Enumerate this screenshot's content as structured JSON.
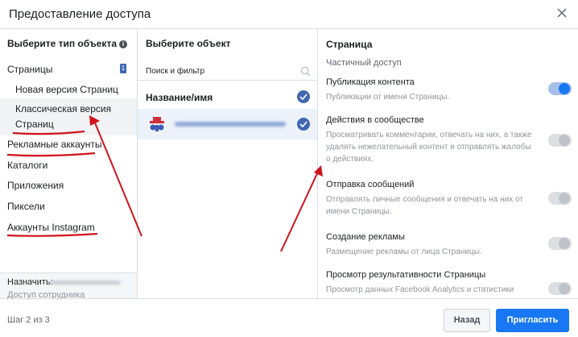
{
  "dialog": {
    "title": "Предоставление доступа"
  },
  "object_types": {
    "header": "Выберите тип объекта",
    "info_icon": "i",
    "pages_label": "Страницы",
    "pages_count": "1",
    "new_version": "Новая версия Страниц",
    "classic_version": "Классическая версия Страниц",
    "items": [
      "Рекламные аккаунты",
      "Каталоги",
      "Приложения",
      "Пиксели",
      "Аккаунты Instagram"
    ]
  },
  "assign": {
    "label": "Назначить:",
    "sub": "Доступ сотрудника"
  },
  "objects": {
    "header": "Выберите объект",
    "search_placeholder": "Поиск и фильтр",
    "name_column": "Название/имя"
  },
  "permissions": {
    "header": "Страница",
    "section": "Частичный доступ",
    "items": [
      {
        "title": "Публикация контента",
        "desc": "Публикации от имени Страницы.",
        "on": true
      },
      {
        "title": "Действия в сообществе",
        "desc": "Просматривать комментарии, отвечать на них, а также удалять нежелательный контент и отправлять жалобы о действиях.",
        "on": false
      },
      {
        "title": "Отправка сообщений",
        "desc": "Отправлять личные сообщения и отвечать на них от имени Страницы.",
        "on": false
      },
      {
        "title": "Создание рекламы",
        "desc": "Размещение рекламы от лица Страницы.",
        "on": false
      },
      {
        "title": "Просмотр результативности Страницы",
        "desc": "Просмотр данных Facebook Analytics и статистики",
        "on": false
      }
    ]
  },
  "footer": {
    "step": "Шаг 2 из 3",
    "back": "Назад",
    "invite": "Пригласить"
  },
  "colors": {
    "accent": "#1877f2",
    "annotation": "#d0141c"
  }
}
